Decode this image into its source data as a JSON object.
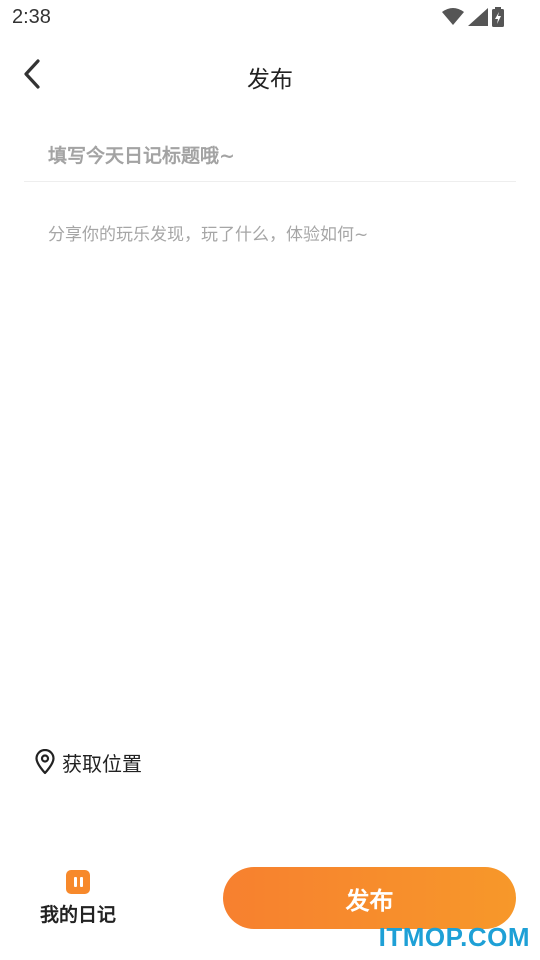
{
  "status_bar": {
    "time": "2:38",
    "icons": [
      "wifi-icon",
      "signal-icon",
      "battery-charging-icon"
    ]
  },
  "header": {
    "back_icon": "chevron-left-icon",
    "title": "发布"
  },
  "form": {
    "title_placeholder": "填写今天日记标题哦~",
    "title_value": "",
    "content_placeholder": "分享你的玩乐发现，玩了什么，体验如何~",
    "content_value": ""
  },
  "location": {
    "icon": "location-pin-icon",
    "label": "获取位置"
  },
  "bottom_bar": {
    "diary_icon": "diary-icon",
    "diary_label": "我的日记",
    "publish_label": "发布"
  },
  "watermark": "ITMOP.COM",
  "colors": {
    "accent_start": "#f7802f",
    "accent_end": "#f7982a",
    "watermark": "#1ea0d6"
  }
}
